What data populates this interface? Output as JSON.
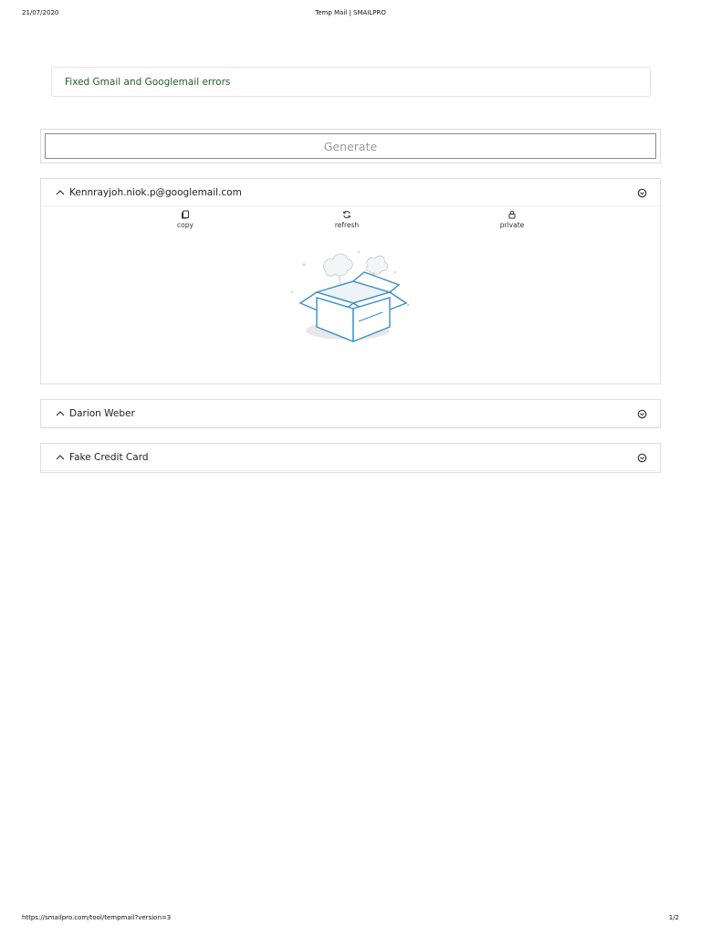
{
  "print_header": {
    "date": "21/07/2020",
    "title": "Temp Mail | SMAILPRO"
  },
  "notice": {
    "text": "Fixed Gmail and Googlemail errors"
  },
  "generate": {
    "label": "Generate"
  },
  "panels": [
    {
      "title": "Kennrayjoh.niok.p@googlemail.com",
      "actions": [
        {
          "label": "copy",
          "icon": "copy-icon"
        },
        {
          "label": "refresh",
          "icon": "refresh-icon"
        },
        {
          "label": "private",
          "icon": "lock-icon"
        }
      ],
      "empty_illustration": "empty-box-illustration"
    },
    {
      "title": "Darion Weber"
    },
    {
      "title": "Fake Credit Card"
    }
  ],
  "print_footer": {
    "url": "https://smailpro.com/tool/tempmail?version=3",
    "page": "1/2"
  },
  "colors": {
    "notice_text": "#1f5f1f",
    "border": "#dedede",
    "illustration_blue": "#3a8fc8"
  }
}
